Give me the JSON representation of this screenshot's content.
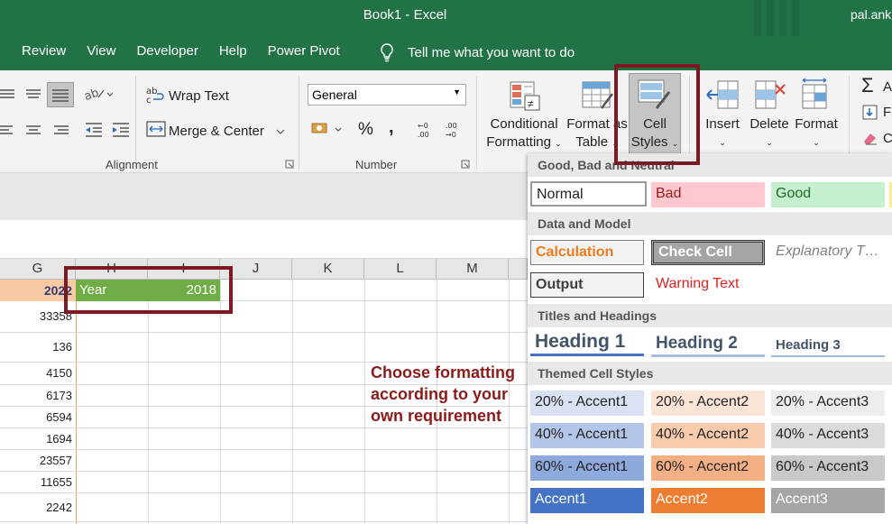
{
  "window": {
    "title": "Book1  -  Excel",
    "user": "pal.ank"
  },
  "menu": {
    "items": [
      "Review",
      "View",
      "Developer",
      "Help",
      "Power Pivot"
    ],
    "tell_me": "Tell me what you want to do"
  },
  "ribbon": {
    "alignment": {
      "wrap_text": "Wrap Text",
      "merge_center": "Merge & Center",
      "label": "Alignment"
    },
    "number": {
      "format": "General",
      "label": "Number",
      "percent": "%",
      "comma": ","
    },
    "styles": {
      "conditional_formatting": [
        "Conditional",
        "Formatting"
      ],
      "format_as_table": [
        "Format as",
        "Table"
      ],
      "cell_styles": [
        "Cell",
        "Styles"
      ]
    },
    "cells": {
      "insert": "Insert",
      "delete": "Delete",
      "format": "Format"
    },
    "editing": {
      "fill_partial": "Fi",
      "clear_partial": "C",
      "autosum_partial": "A"
    }
  },
  "grid": {
    "columns": [
      "G",
      "H",
      "I",
      "J",
      "K",
      "L",
      "M"
    ],
    "header_row": {
      "g": "2022",
      "h": "Year",
      "i": "2018"
    },
    "g_values": [
      "33358",
      "136",
      "4150",
      "6173",
      "6594",
      "1694",
      "23557",
      "11655",
      "2242"
    ]
  },
  "annotation": "Choose formatting according to your own requirement",
  "cell_styles": {
    "good_bad_neutral": {
      "heading": "Good, Bad and Neutral",
      "items": [
        "Normal",
        "Bad",
        "Good"
      ]
    },
    "data_model": {
      "heading": "Data and Model",
      "items": [
        "Calculation",
        "Check Cell",
        "Explanatory T…",
        "Output",
        "Warning Text"
      ]
    },
    "titles": {
      "heading": "Titles and Headings",
      "items": [
        "Heading 1",
        "Heading 2",
        "Heading 3"
      ]
    },
    "themed": {
      "heading": "Themed Cell Styles",
      "rows": [
        [
          "20% - Accent1",
          "20% - Accent2",
          "20% - Accent3"
        ],
        [
          "40% - Accent1",
          "40% - Accent2",
          "40% - Accent3"
        ],
        [
          "60% - Accent1",
          "60% - Accent2",
          "60% - Accent3"
        ],
        [
          "Accent1",
          "Accent2",
          "Accent3"
        ]
      ]
    }
  },
  "colors": {
    "excel_green": "#217346",
    "highlight_red": "#7b1a22",
    "annotation": "#8b1a1a",
    "year_green": "#70ad47",
    "header_orange": "#f8cba5"
  }
}
